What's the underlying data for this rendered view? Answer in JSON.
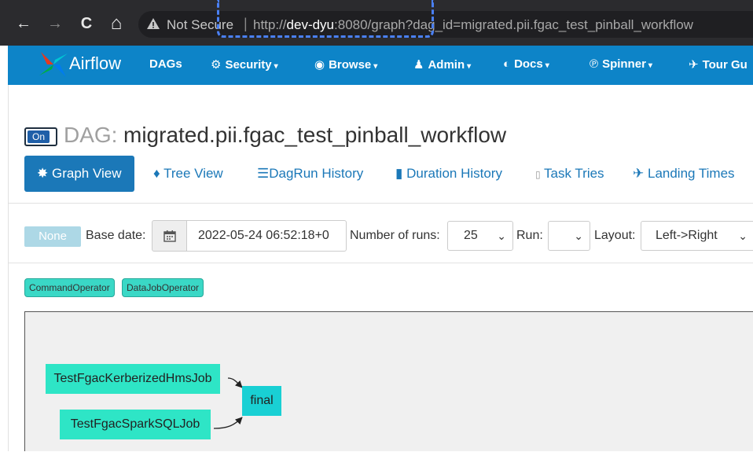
{
  "browser": {
    "not_secure_label": "Not Secure",
    "separator": "|",
    "url_scheme": "http://",
    "url_host": "dev-dyu",
    "url_rest": ":8080/graph?dag_id=migrated.pii.fgac_test_pinball_workflow",
    "back_icon": "←",
    "forward_icon": "→",
    "reload_icon": "C",
    "home_icon": "⌂"
  },
  "nav": {
    "brand": "Airflow",
    "items": [
      {
        "label": "DAGs",
        "icon": ""
      },
      {
        "label": "Security",
        "icon": "⚙",
        "dropdown": true
      },
      {
        "label": "Browse",
        "icon": "◉",
        "dropdown": true
      },
      {
        "label": "Admin",
        "icon": "♟",
        "dropdown": true
      },
      {
        "label": "Docs",
        "icon": "◐",
        "dropdown": true
      },
      {
        "label": "Spinner",
        "icon": "℗",
        "dropdown": true
      },
      {
        "label": "Tour Gu",
        "icon": "✈"
      }
    ],
    "accent": "#0d84c8"
  },
  "dag": {
    "toggle_label": "On",
    "prefix": "DAG:",
    "name": "migrated.pii.fgac_test_pinball_workflow"
  },
  "tabs": [
    {
      "label": "Graph View",
      "icon": "✸",
      "active": true
    },
    {
      "label": "Tree View",
      "icon": "♦"
    },
    {
      "label": "DagRun History",
      "icon": "☰"
    },
    {
      "label": "Duration History",
      "icon": "▮"
    },
    {
      "label": "Task Tries",
      "icon": "▯"
    },
    {
      "label": "Landing Times",
      "icon": "✈"
    }
  ],
  "controls": {
    "state_button": "None",
    "base_date_label": "Base date:",
    "base_date_value": "2022-05-24 06:52:18+0",
    "num_runs_label": "Number of runs:",
    "num_runs_value": "25",
    "run_label": "Run:",
    "run_value": "",
    "layout_label": "Layout:",
    "layout_value": "Left->Right"
  },
  "operators": [
    "CommandOperator",
    "DataJobOperator"
  ],
  "graph": {
    "nodes": [
      "TestFgacKerberizedHmsJob",
      "TestFgacSparkSQLJob",
      "final"
    ],
    "edges": [
      [
        "TestFgacKerberizedHmsJob",
        "final"
      ],
      [
        "TestFgacSparkSQLJob",
        "final"
      ]
    ]
  }
}
